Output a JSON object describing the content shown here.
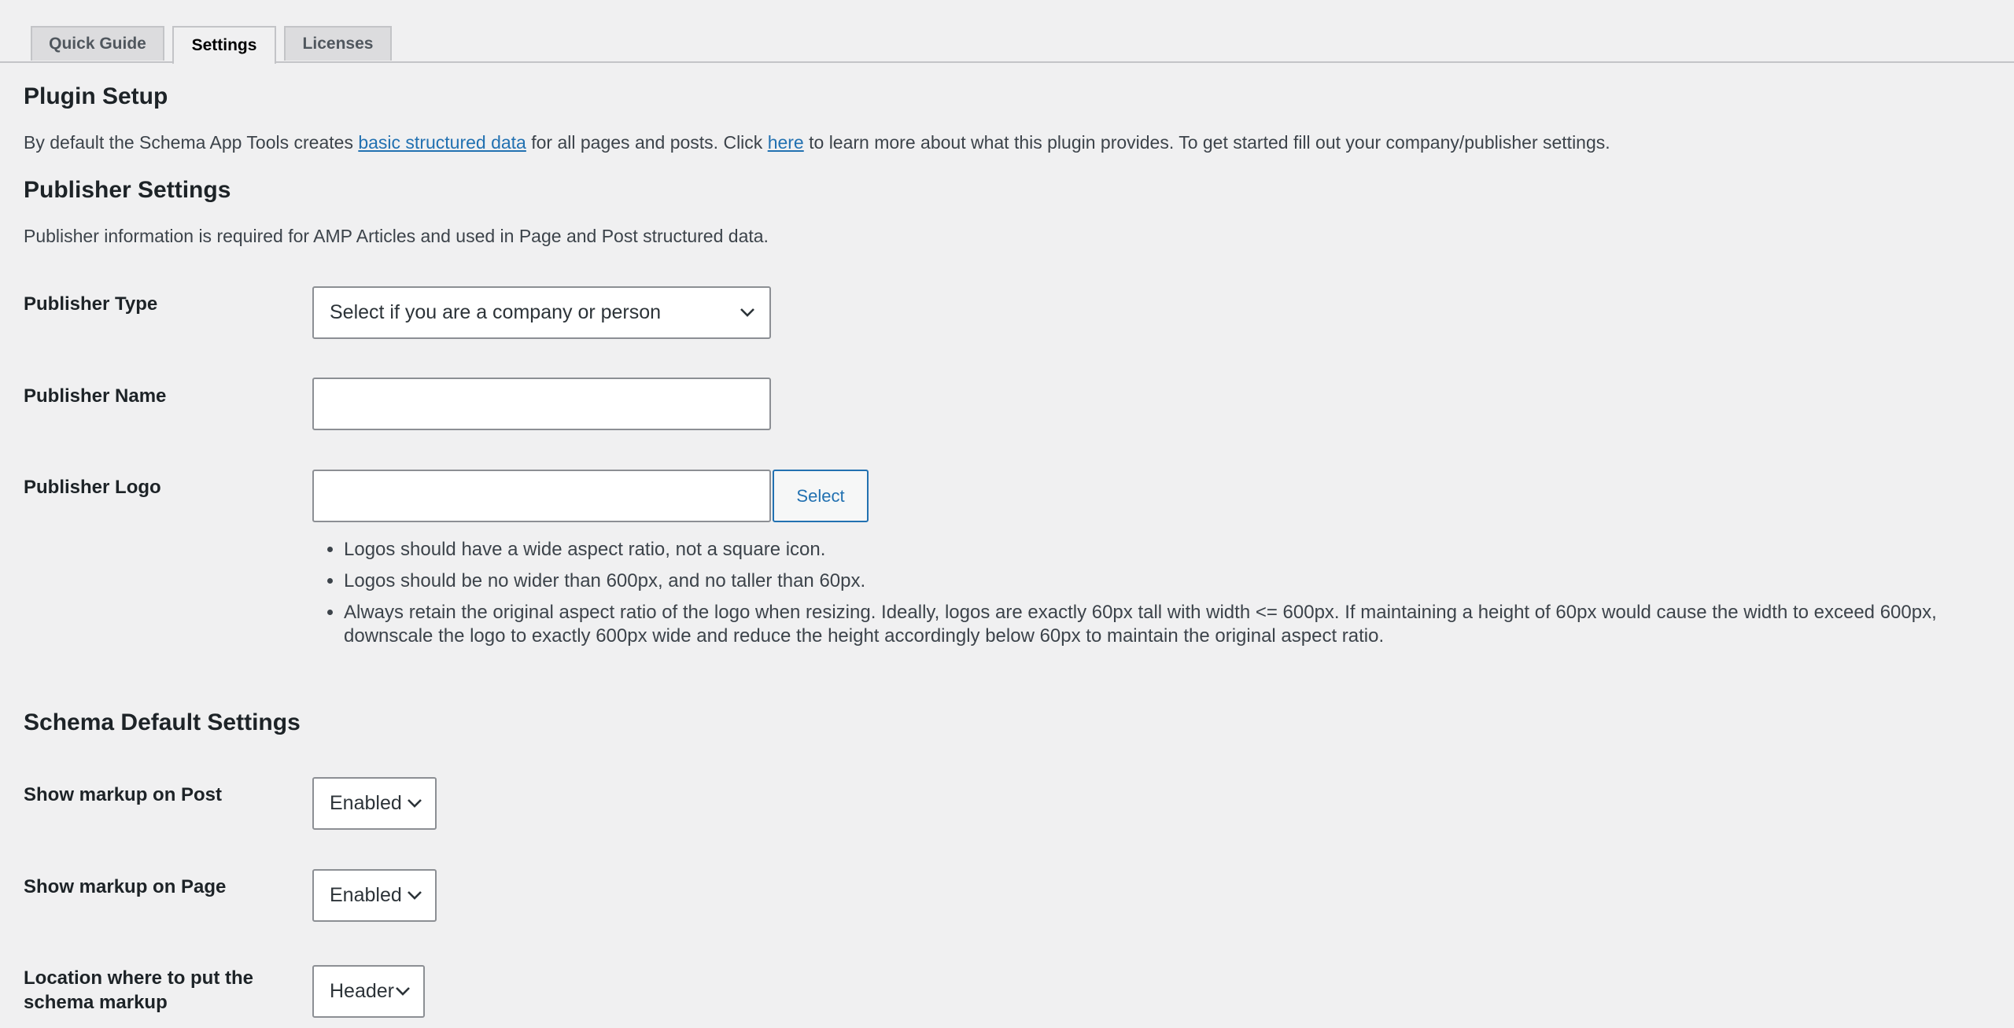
{
  "tabs": [
    {
      "label": "Quick Guide",
      "active": false
    },
    {
      "label": "Settings",
      "active": true
    },
    {
      "label": "Licenses",
      "active": false
    }
  ],
  "plugin_setup": {
    "title": "Plugin Setup",
    "text_before_link1": "By default the Schema App Tools creates ",
    "link1": "basic structured data",
    "text_between": " for all pages and posts. Click ",
    "link2": "here",
    "text_after": " to learn more about what this plugin provides. To get started fill out your company/publisher settings."
  },
  "publisher_settings": {
    "title": "Publisher Settings",
    "description": "Publisher information is required for AMP Articles and used in Page and Post structured data.",
    "type_label": "Publisher Type",
    "type_value": "Select if you are a company or person",
    "name_label": "Publisher Name",
    "name_value": "",
    "logo_label": "Publisher Logo",
    "logo_value": "",
    "select_button": "Select",
    "notes": [
      "Logos should have a wide aspect ratio, not a square icon.",
      "Logos should be no wider than 600px, and no taller than 60px.",
      "Always retain the original aspect ratio of the logo when resizing. Ideally, logos are exactly 60px tall with width <= 600px. If maintaining a height of 60px would cause the width to exceed 600px, downscale the logo to exactly 600px wide and reduce the height accordingly below 60px to maintain the original aspect ratio."
    ]
  },
  "schema_default": {
    "title": "Schema Default Settings",
    "post_label": "Show markup on Post",
    "post_value": "Enabled",
    "page_label": "Show markup on Page",
    "page_value": "Enabled",
    "location_label": "Location where to put the schema markup",
    "location_value": "Header"
  },
  "colors": {
    "background": "#f0f0f1",
    "link": "#2271b1",
    "button_border": "#2271b1"
  },
  "icons": [
    "chevron-down-icon"
  ]
}
